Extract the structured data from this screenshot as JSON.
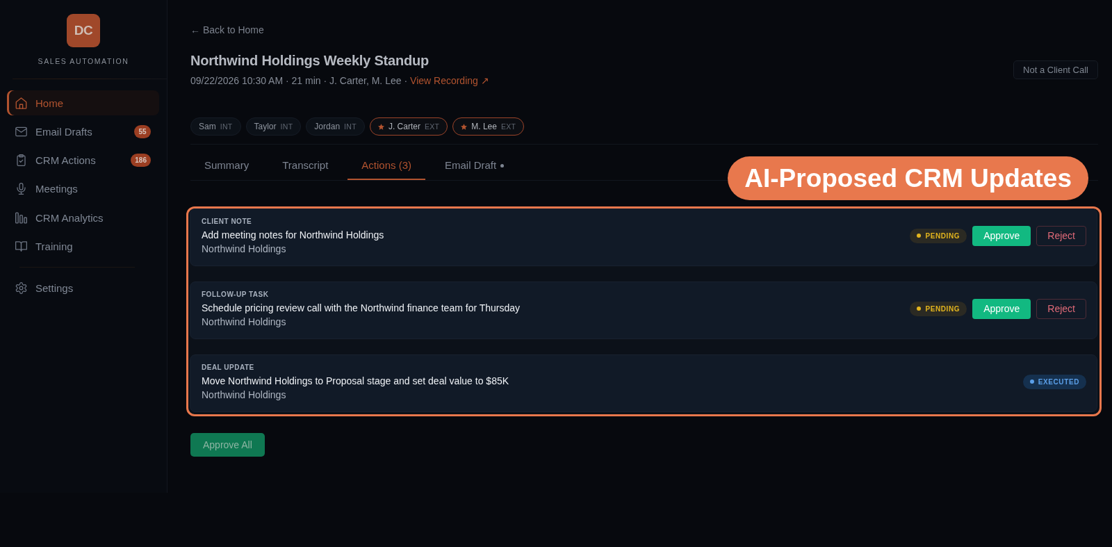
{
  "sidebar": {
    "logo": "DC",
    "app_name": "SALES AUTOMATION",
    "items": [
      {
        "label": "Home",
        "selected": true
      },
      {
        "label": "Email Drafts",
        "badge": "55",
        "selected": false
      },
      {
        "label": "CRM Actions",
        "badge": "186",
        "selected": false
      },
      {
        "label": "Meetings",
        "selected": false
      },
      {
        "label": "CRM Analytics",
        "selected": false
      },
      {
        "label": "Training",
        "selected": false
      }
    ],
    "footer_items": [
      {
        "label": "Settings",
        "selected": false
      }
    ]
  },
  "header": {
    "back_link": "← Back to Home",
    "title": "Northwind Holdings Weekly Standup",
    "details": "09/22/2026 10:30 AM · 21 min · J. Carter, M. Lee ·",
    "recording_link": "View Recording ↗",
    "action_button": "Not a Client Call"
  },
  "participants": [
    {
      "name": "Sam",
      "tag": "INT",
      "external": false
    },
    {
      "name": "Taylor",
      "tag": "INT",
      "external": false
    },
    {
      "name": "Jordan",
      "tag": "INT",
      "external": false
    },
    {
      "name": "J. Carter",
      "tag": "EXT",
      "external": true
    },
    {
      "name": "M. Lee",
      "tag": "EXT",
      "external": true
    }
  ],
  "tabs": [
    {
      "label": "Summary",
      "selected": false,
      "dot": false
    },
    {
      "label": "Transcript",
      "selected": false,
      "dot": false
    },
    {
      "label": "Actions (3)",
      "selected": true,
      "dot": false
    },
    {
      "label": "Email Draft",
      "selected": false,
      "dot": true
    }
  ],
  "callout": "AI-Proposed CRM Updates",
  "actions": [
    {
      "category": "CLIENT NOTE",
      "title": "Add meeting notes for Northwind Holdings",
      "company": "Northwind Holdings",
      "status": "PENDING",
      "kind": "pending",
      "approve_button": "Approve",
      "reject_button": "Reject"
    },
    {
      "category": "FOLLOW-UP TASK",
      "title": "Schedule pricing review call with the Northwind finance team for Thursday",
      "company": "Northwind Holdings",
      "status": "PENDING",
      "kind": "pending",
      "approve_button": "Approve",
      "reject_button": "Reject"
    },
    {
      "category": "DEAL UPDATE",
      "title": "Move Northwind Holdings to Proposal stage and set deal value to $85K",
      "company": "Northwind Holdings",
      "status": "EXECUTED",
      "kind": "executed"
    }
  ],
  "approve_all_button": "Approve All"
}
